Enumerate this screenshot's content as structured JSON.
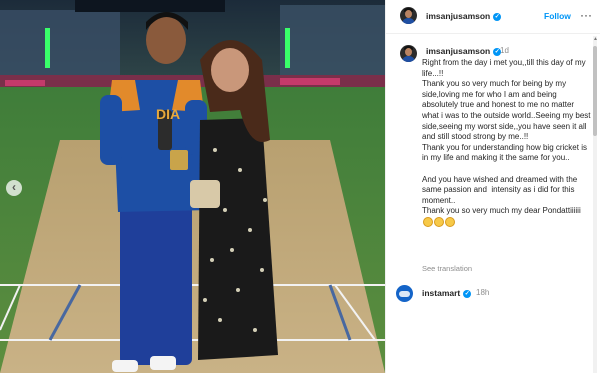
{
  "post": {
    "image_alt": "Cricketer in blue India jersey holding a trophy, standing with a woman in a black floral dress on a stadium pitch at night",
    "jersey_text": "DIA",
    "nav_prev_icon": "chevron-left-icon"
  },
  "header": {
    "username": "imsanjusamson",
    "follow_label": "Follow",
    "more_label": "···"
  },
  "comment": {
    "username": "imsanjusamson",
    "time": "1d",
    "caption": "Right from the day i met you,,till this day of my life...!!\nThank you so very much for being by my side,loving me for who I am and being absolutely true and honest to me no matter what i was to the outside world..Seeing my best side,seeing my worst side,,you have seen it all and still stood strong by me..!!\nThank you for understanding how big cricket is in my life and making it the same for you..\n\nAnd you have wished and dreamed with the same passion and  intensity as i did for this moment..\nThank you so very much my dear Pondattiiiiii",
    "emoji_count": 3,
    "see_translation": "See translation"
  },
  "reply": {
    "username": "instamart",
    "time": "18h"
  },
  "colors": {
    "accent": "#0095f6",
    "verified": "#0095f6",
    "muted": "#8e8e8e",
    "jersey": "#1d4fa5"
  }
}
